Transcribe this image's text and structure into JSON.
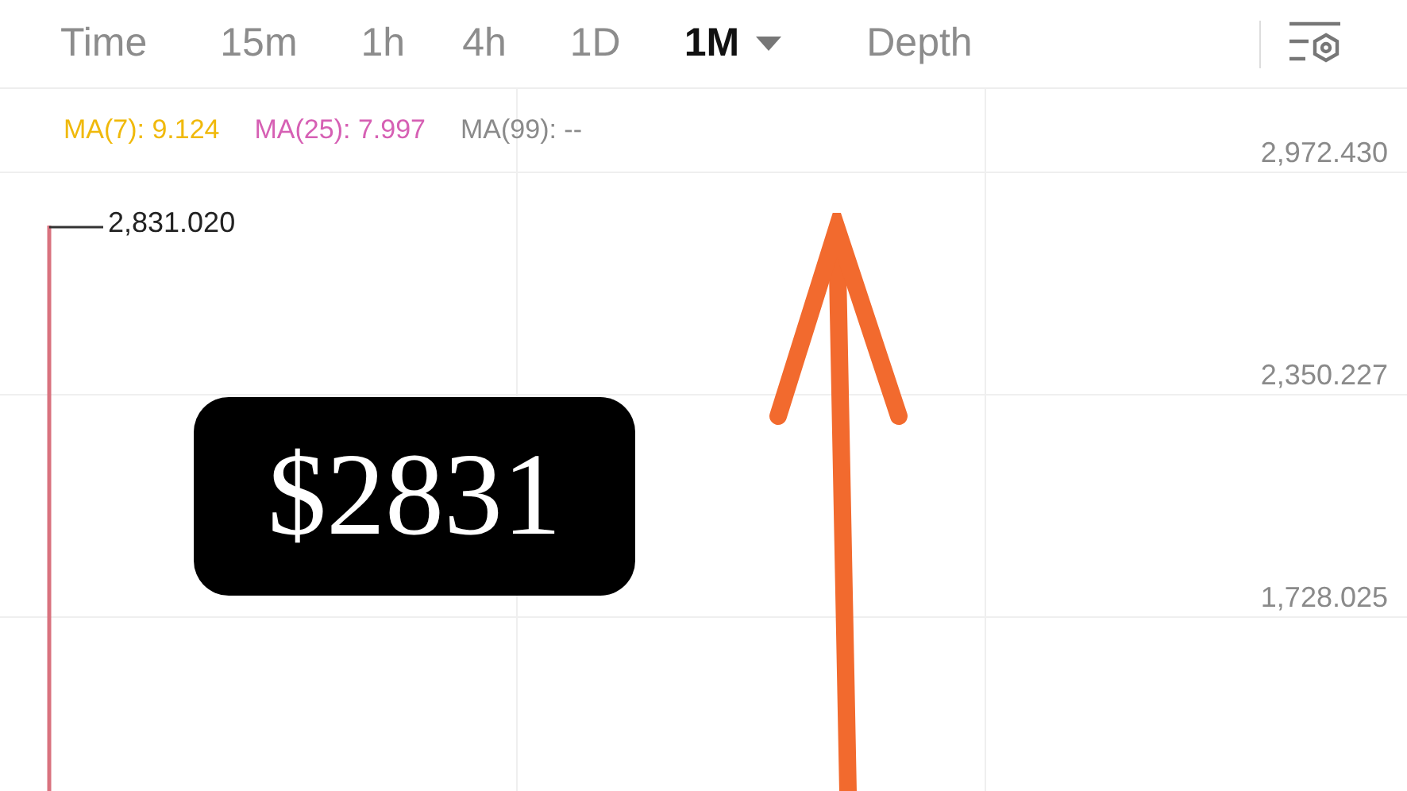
{
  "tabs": [
    {
      "label": "Time",
      "selected": false,
      "dropdown": false
    },
    {
      "label": "15m",
      "selected": false,
      "dropdown": false
    },
    {
      "label": "1h",
      "selected": false,
      "dropdown": false
    },
    {
      "label": "4h",
      "selected": false,
      "dropdown": false
    },
    {
      "label": "1D",
      "selected": false,
      "dropdown": false
    },
    {
      "label": "1M",
      "selected": true,
      "dropdown": true
    },
    {
      "label": "Depth",
      "selected": false,
      "dropdown": false
    }
  ],
  "indicators": [
    {
      "label": "MA(7): 9.124",
      "color": "#f0b90b"
    },
    {
      "label": "MA(25): 7.997",
      "color": "#d660b4"
    },
    {
      "label": "MA(99): --",
      "color": "#8a8a8a"
    }
  ],
  "price_axis": [
    "2,972.430",
    "2,350.227",
    "1,728.025"
  ],
  "high_marker": "2,831.020",
  "callout": "$2831"
}
